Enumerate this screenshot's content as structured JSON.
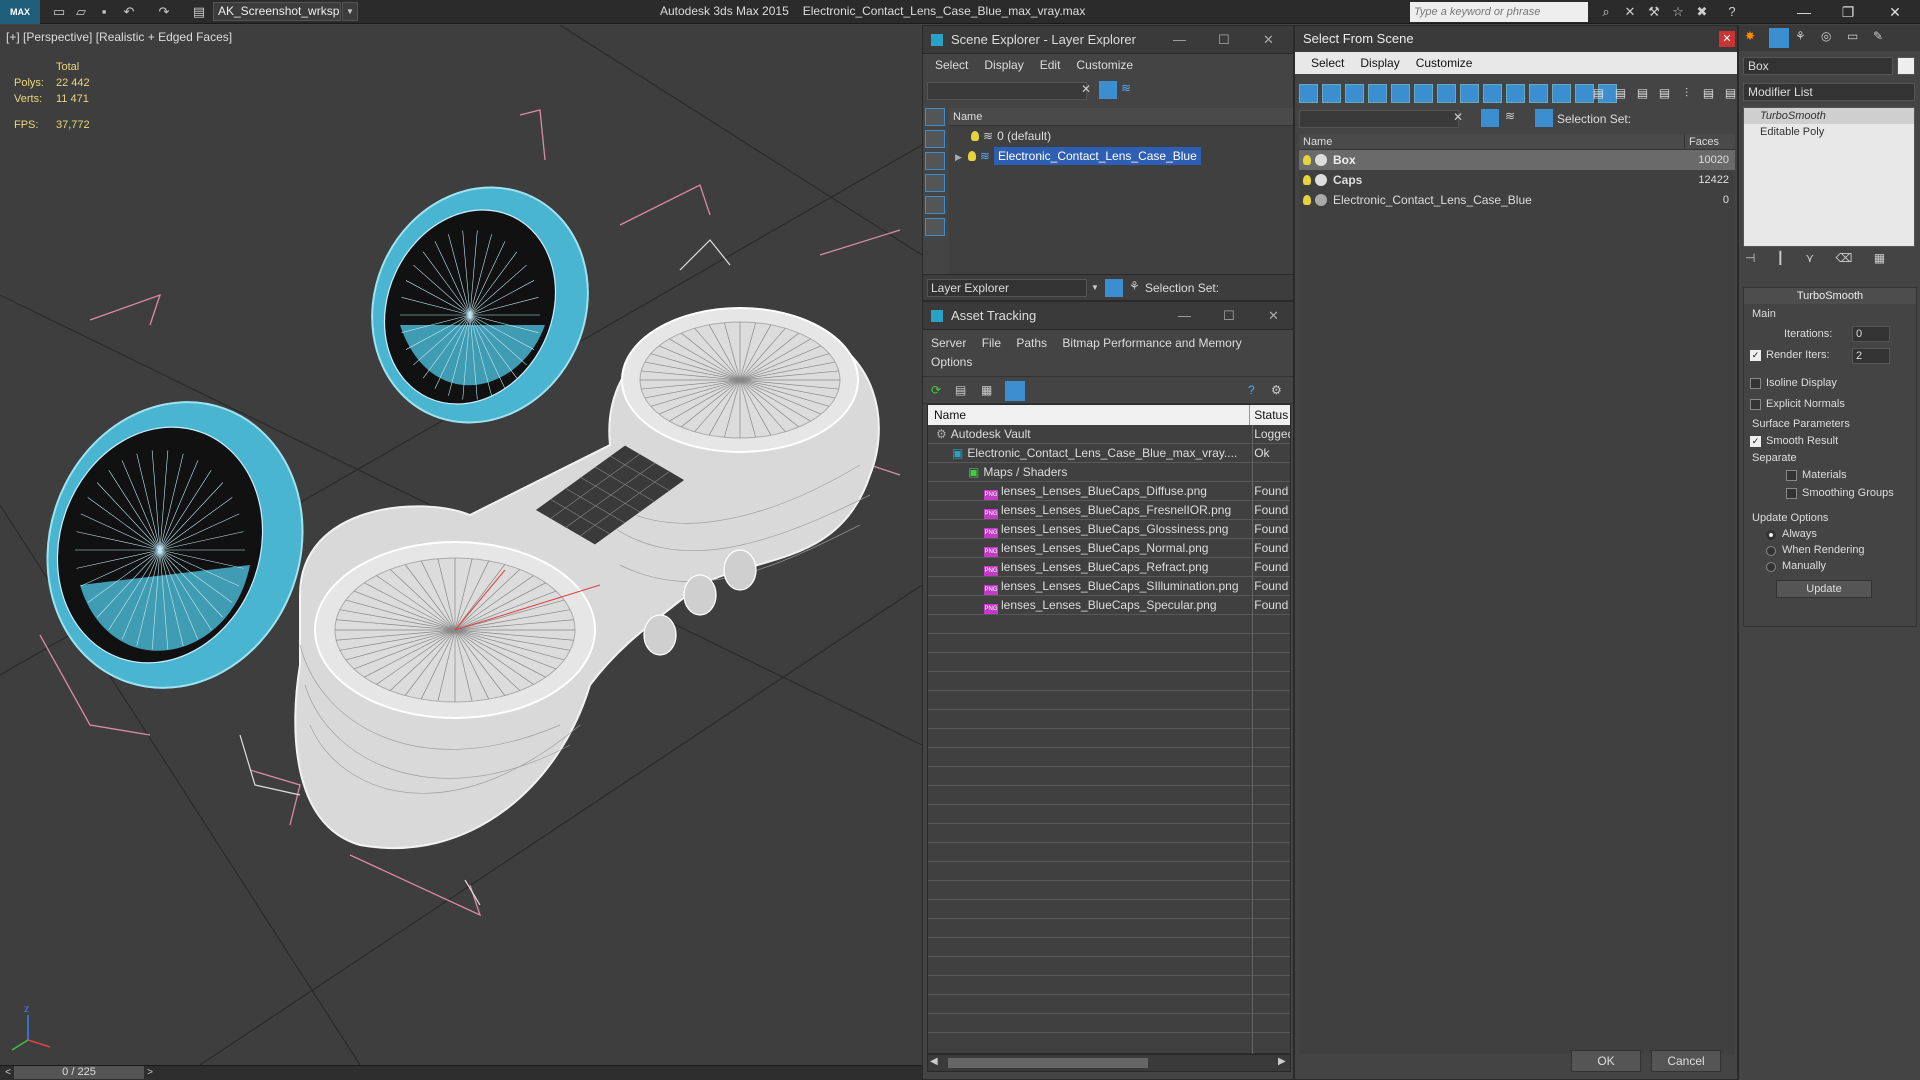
{
  "titlebar": {
    "logo": "MAX",
    "workspace": "AK_Screenshot_wrksp",
    "app_name": "Autodesk 3ds Max  2015",
    "file_name": "Electronic_Contact_Lens_Case_Blue_max_vray.max",
    "search_placeholder": "Type a keyword or phrase"
  },
  "viewport": {
    "label": "[+] [Perspective] [Realistic + Edged Faces]",
    "stats": {
      "total_label": "Total",
      "polys_label": "Polys:",
      "polys_value": "22 442",
      "verts_label": "Verts:",
      "verts_value": "11 471",
      "fps_label": "FPS:",
      "fps_value": "37,772"
    },
    "axis": {
      "z": "z",
      "x": "x",
      "y": "y"
    }
  },
  "timeline": {
    "frame": "0 / 225",
    "prev": "<",
    "next": ">"
  },
  "scene_explorer": {
    "title": "Scene Explorer - Layer Explorer",
    "menu": [
      "Select",
      "Display",
      "Edit",
      "Customize"
    ],
    "column_name": "Name",
    "rows": [
      "0 (default)",
      "Electronic_Contact_Lens_Case_Blue"
    ],
    "footer_label": "Layer Explorer",
    "selection_set_label": "Selection Set:"
  },
  "asset_tracking": {
    "title": "Asset Tracking",
    "menu": [
      "Server",
      "File",
      "Paths",
      "Bitmap Performance and Memory",
      "Options"
    ],
    "col_name": "Name",
    "col_status": "Status",
    "rows": [
      {
        "name": "Autodesk Vault",
        "status": "Logged",
        "indent": 0
      },
      {
        "name": "Electronic_Contact_Lens_Case_Blue_max_vray....",
        "status": "Ok",
        "indent": 1
      },
      {
        "name": "Maps / Shaders",
        "status": "",
        "indent": 2
      },
      {
        "name": "lenses_Lenses_BlueCaps_Diffuse.png",
        "status": "Found",
        "indent": 3
      },
      {
        "name": "lenses_Lenses_BlueCaps_FresnelIOR.png",
        "status": "Found",
        "indent": 3
      },
      {
        "name": "lenses_Lenses_BlueCaps_Glossiness.png",
        "status": "Found",
        "indent": 3
      },
      {
        "name": "lenses_Lenses_BlueCaps_Normal.png",
        "status": "Found",
        "indent": 3
      },
      {
        "name": "lenses_Lenses_BlueCaps_Refract.png",
        "status": "Found",
        "indent": 3
      },
      {
        "name": "lenses_Lenses_BlueCaps_SIllumination.png",
        "status": "Found",
        "indent": 3
      },
      {
        "name": "lenses_Lenses_BlueCaps_Specular.png",
        "status": "Found",
        "indent": 3
      }
    ]
  },
  "select_from_scene": {
    "title": "Select From Scene",
    "menu": [
      "Select",
      "Display",
      "Customize"
    ],
    "selection_set_label": "Selection Set:",
    "col_name": "Name",
    "col_faces": "Faces",
    "rows": [
      {
        "name": "Box",
        "faces": "10020"
      },
      {
        "name": "Caps",
        "faces": "12422"
      },
      {
        "name": "Electronic_Contact_Lens_Case_Blue",
        "faces": "0"
      }
    ],
    "ok": "OK",
    "cancel": "Cancel"
  },
  "command_panel": {
    "object_name": "Box",
    "modifier_list": "Modifier List",
    "stack": [
      "TurboSmooth",
      "Editable Poly"
    ],
    "rollout_title": "TurboSmooth",
    "main_label": "Main",
    "iterations_label": "Iterations:",
    "iterations_value": "0",
    "render_iters_label": "Render Iters:",
    "render_iters_value": "2",
    "isoline": "Isoline Display",
    "explicit_normals": "Explicit Normals",
    "surface_params": "Surface Parameters",
    "smooth_result": "Smooth Result",
    "separate": "Separate",
    "materials": "Materials",
    "smoothing_groups": "Smoothing Groups",
    "update_options": "Update Options",
    "always": "Always",
    "when_rendering": "When Rendering",
    "manually": "Manually",
    "update_button": "Update"
  },
  "colors": {
    "accent_blue": "#3b8ed0",
    "caps_cyan": "#49b5d0",
    "selection": "#2f5fb5"
  }
}
